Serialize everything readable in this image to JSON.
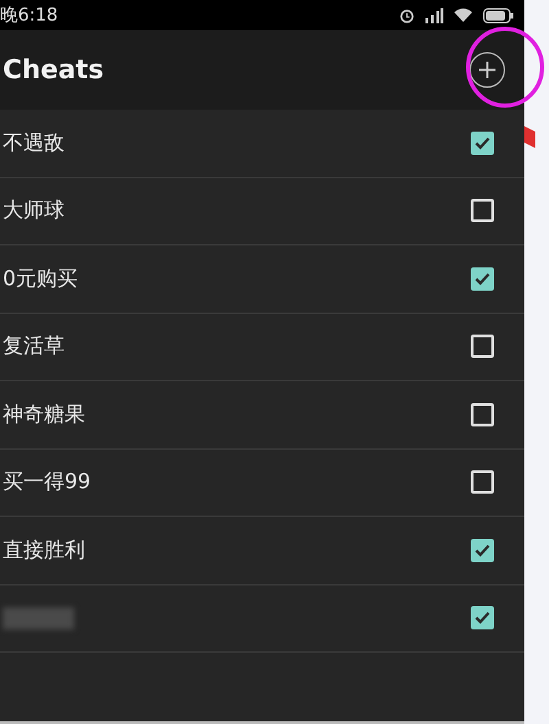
{
  "status_bar": {
    "time": "晚6:18"
  },
  "header": {
    "title": "Cheats",
    "add_button_circled": true
  },
  "cheats": [
    {
      "name": "不遇敌",
      "checked": true
    },
    {
      "name": "大师球",
      "checked": false
    },
    {
      "name": "0元购买",
      "checked": true
    },
    {
      "name": "复活草",
      "checked": false
    },
    {
      "name": "神奇糖果",
      "checked": false
    },
    {
      "name": "买一得99",
      "checked": false
    },
    {
      "name": "直接胜利",
      "checked": true
    },
    {
      "kind": "blurred",
      "checked": true
    }
  ]
}
